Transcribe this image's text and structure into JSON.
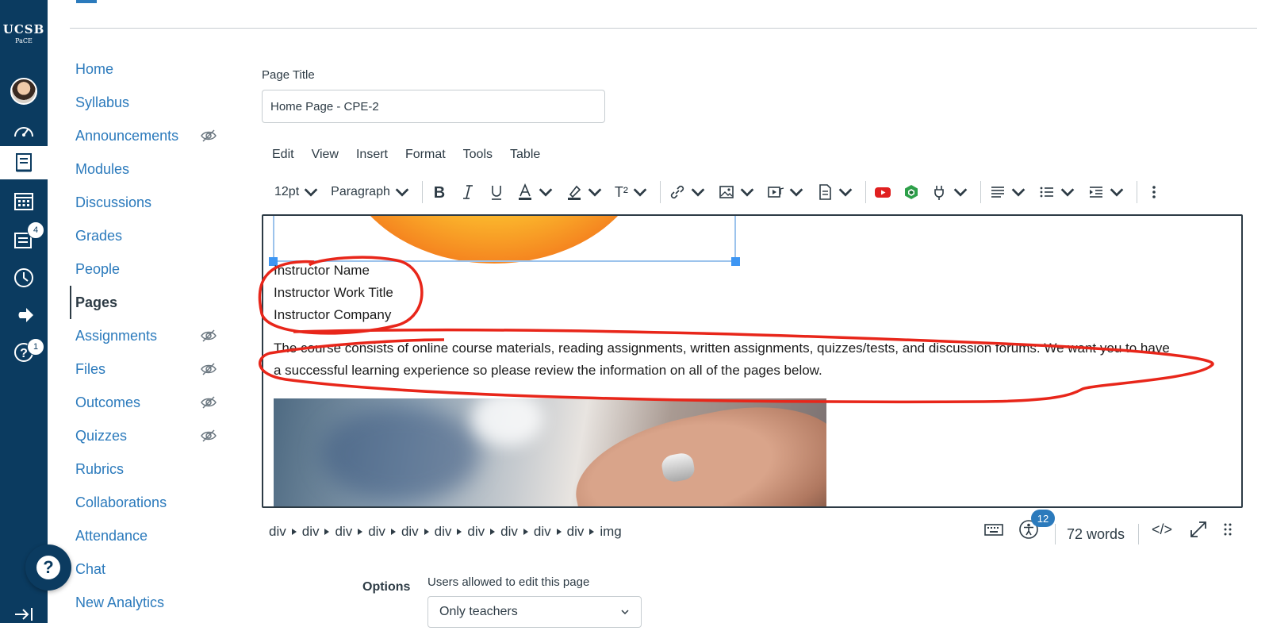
{
  "global_nav": {
    "logo_main": "UCSB",
    "logo_sub": "PaCE",
    "inbox_badge": "4",
    "help_badge": "1"
  },
  "course_nav": {
    "items": [
      {
        "label": "Home"
      },
      {
        "label": "Syllabus"
      },
      {
        "label": "Announcements",
        "hidden_icon": true
      },
      {
        "label": "Modules"
      },
      {
        "label": "Discussions"
      },
      {
        "label": "Grades"
      },
      {
        "label": "People"
      },
      {
        "label": "Pages",
        "active": true
      },
      {
        "label": "Assignments",
        "hidden_icon": true
      },
      {
        "label": "Files",
        "hidden_icon": true
      },
      {
        "label": "Outcomes",
        "hidden_icon": true
      },
      {
        "label": "Quizzes",
        "hidden_icon": true
      },
      {
        "label": "Rubrics"
      },
      {
        "label": "Collaborations"
      },
      {
        "label": "Attendance"
      },
      {
        "label": "Chat"
      },
      {
        "label": "New Analytics"
      }
    ]
  },
  "page_title": {
    "label": "Page Title",
    "value": "Home Page - CPE-2"
  },
  "editor": {
    "menu": [
      "Edit",
      "View",
      "Insert",
      "Format",
      "Tools",
      "Table"
    ],
    "font_size": "12pt",
    "block_format": "Paragraph",
    "superscript_label": "T²",
    "content": {
      "instructor_name": "Instructor Name",
      "instructor_title": "Instructor Work Title",
      "instructor_company": "Instructor Company",
      "paragraph_line1": "The course consists of online course materials, reading assignments, written assignments, quizzes/tests, and discussion forums. We want you to have",
      "paragraph_line2": "a successful learning experience so please review the information on all of the pages below."
    },
    "element_path": [
      "div",
      "div",
      "div",
      "div",
      "div",
      "div",
      "div",
      "div",
      "div",
      "div",
      "img"
    ],
    "a11y_issues": "12",
    "word_count": "72 words",
    "html_toggle": "</>"
  },
  "options": {
    "label": "Options",
    "edit_permission_label": "Users allowed to edit this page",
    "edit_permission_value": "Only teachers"
  },
  "colors": {
    "nav_bg": "#0b3b60",
    "link": "#2b7abc",
    "annotation": "#e8261a"
  }
}
